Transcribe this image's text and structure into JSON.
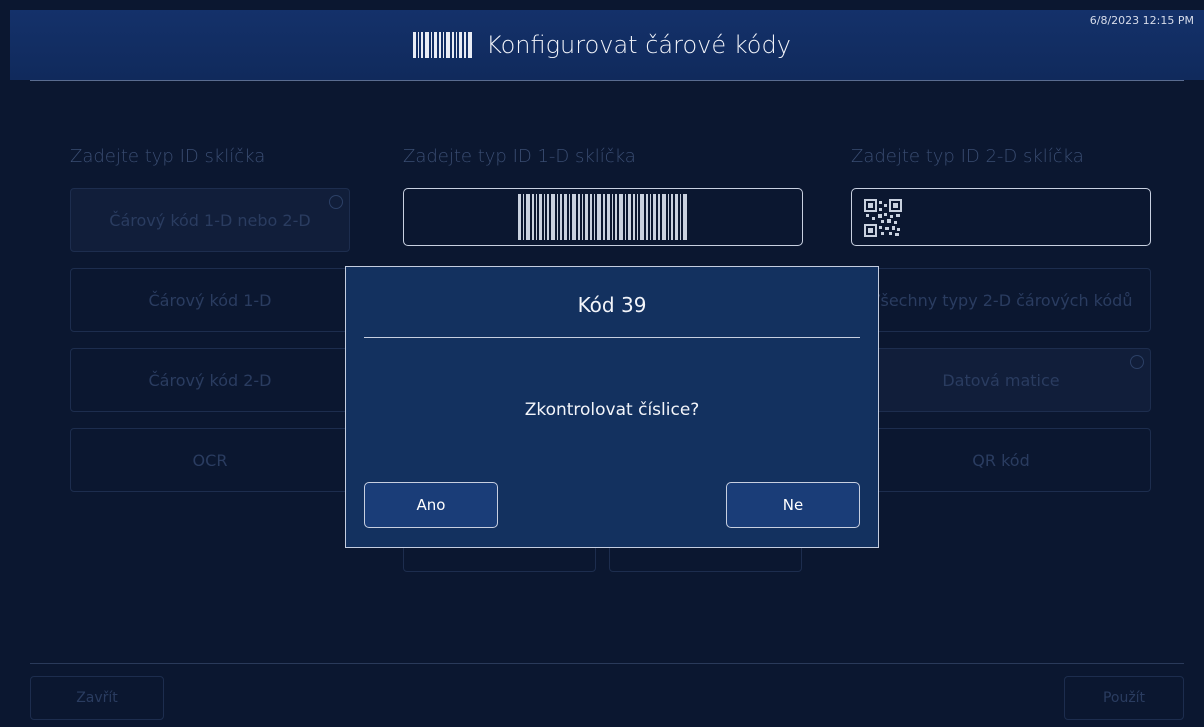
{
  "header": {
    "title": "Konfigurovat čárové kódy",
    "datetime": "6/8/2023 12:15 PM"
  },
  "columns": {
    "slide_id_type": {
      "label": "Zadejte typ ID sklíčka",
      "options": [
        "Čárový kód 1-D nebo 2-D",
        "Čárový kód 1-D",
        "Čárový kód 2-D",
        "OCR"
      ]
    },
    "one_d_type": {
      "label": "Zadejte typ ID 1-D sklíčka"
    },
    "two_d_type": {
      "label": "Zadejte typ ID 2-D sklíčka",
      "options": [
        "Všechny typy 2-D čárových kódů",
        "Datová matice",
        "QR kód"
      ]
    }
  },
  "footer": {
    "close_label": "Zavřít",
    "apply_label": "Použít"
  },
  "modal": {
    "title": "Kód 39",
    "question": "Zkontrolovat číslice?",
    "yes_label": "Ano",
    "no_label": "Ne"
  }
}
